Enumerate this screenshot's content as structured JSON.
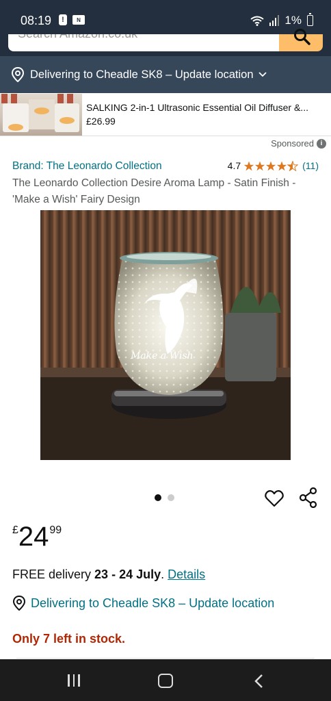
{
  "status_bar": {
    "time": "08:19",
    "battery": "1%",
    "icons": [
      "alert-icon",
      "nfc-icon",
      "wifi-icon",
      "signal-icon",
      "battery-icon"
    ]
  },
  "search": {
    "placeholder": "Search Amazon.co.uk"
  },
  "location_bar": {
    "text": "Delivering to Cheadle SK8 – Update location"
  },
  "sponsored_ad": {
    "title": "SALKING 2-in-1 Ultrasonic Essential Oil Diffuser &...",
    "price": "£26.99"
  },
  "sponsored_label": "Sponsored",
  "product": {
    "brand_link": "Brand: The Leonardo Collection",
    "rating_value": "4.7",
    "rating": 4.5,
    "rating_max": 5,
    "rating_count": "(11)",
    "title": "The Leonardo Collection Desire Aroma Lamp - Satin Finish - 'Make a Wish' Fairy Design",
    "image_inscription": "Make a Wish",
    "image_count": 2,
    "active_image_index": 0,
    "price": {
      "symbol": "£",
      "whole": "24",
      "fraction": "99"
    }
  },
  "delivery": {
    "prefix": "FREE delivery",
    "dates": "23 - 24 July",
    "period": ".",
    "details_link": "Details",
    "deliver_to": "Delivering to Cheadle SK8 – Update location"
  },
  "stock": "Only 7 left in stock.",
  "colors": {
    "header_dark": "#232f3e",
    "location_bar": "#37475a",
    "search_button": "#febd69",
    "link": "#007185",
    "star": "#de7921",
    "stock_red": "#b12704"
  },
  "nav_bar": {
    "icons": [
      "recent-apps-icon",
      "home-icon",
      "back-icon"
    ]
  }
}
